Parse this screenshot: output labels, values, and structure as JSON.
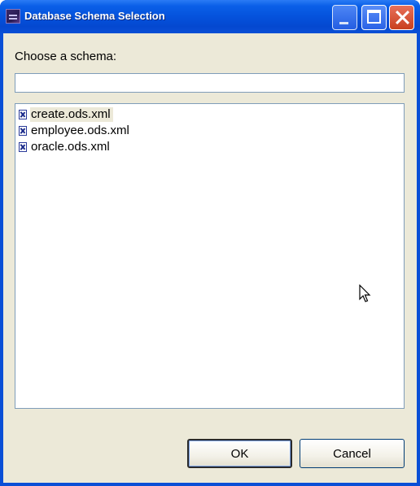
{
  "window": {
    "title": "Database Schema Selection"
  },
  "dialog": {
    "prompt_label": "Choose a schema:",
    "filter_value": "",
    "filter_placeholder": "",
    "schemas": [
      {
        "label": "create.ods.xml",
        "selected": true
      },
      {
        "label": "employee.ods.xml",
        "selected": false
      },
      {
        "label": "oracle.ods.xml",
        "selected": false
      }
    ]
  },
  "buttons": {
    "ok_label": "OK",
    "cancel_label": "Cancel"
  },
  "colors": {
    "titlebar": "#0a4fd6",
    "client_bg": "#ece9d8",
    "close_button": "#c8401e",
    "field_border": "#7f9db9"
  },
  "icons": {
    "app": "app-window-icon",
    "file": "xml-file-icon",
    "cursor": "mouse-pointer-icon"
  }
}
